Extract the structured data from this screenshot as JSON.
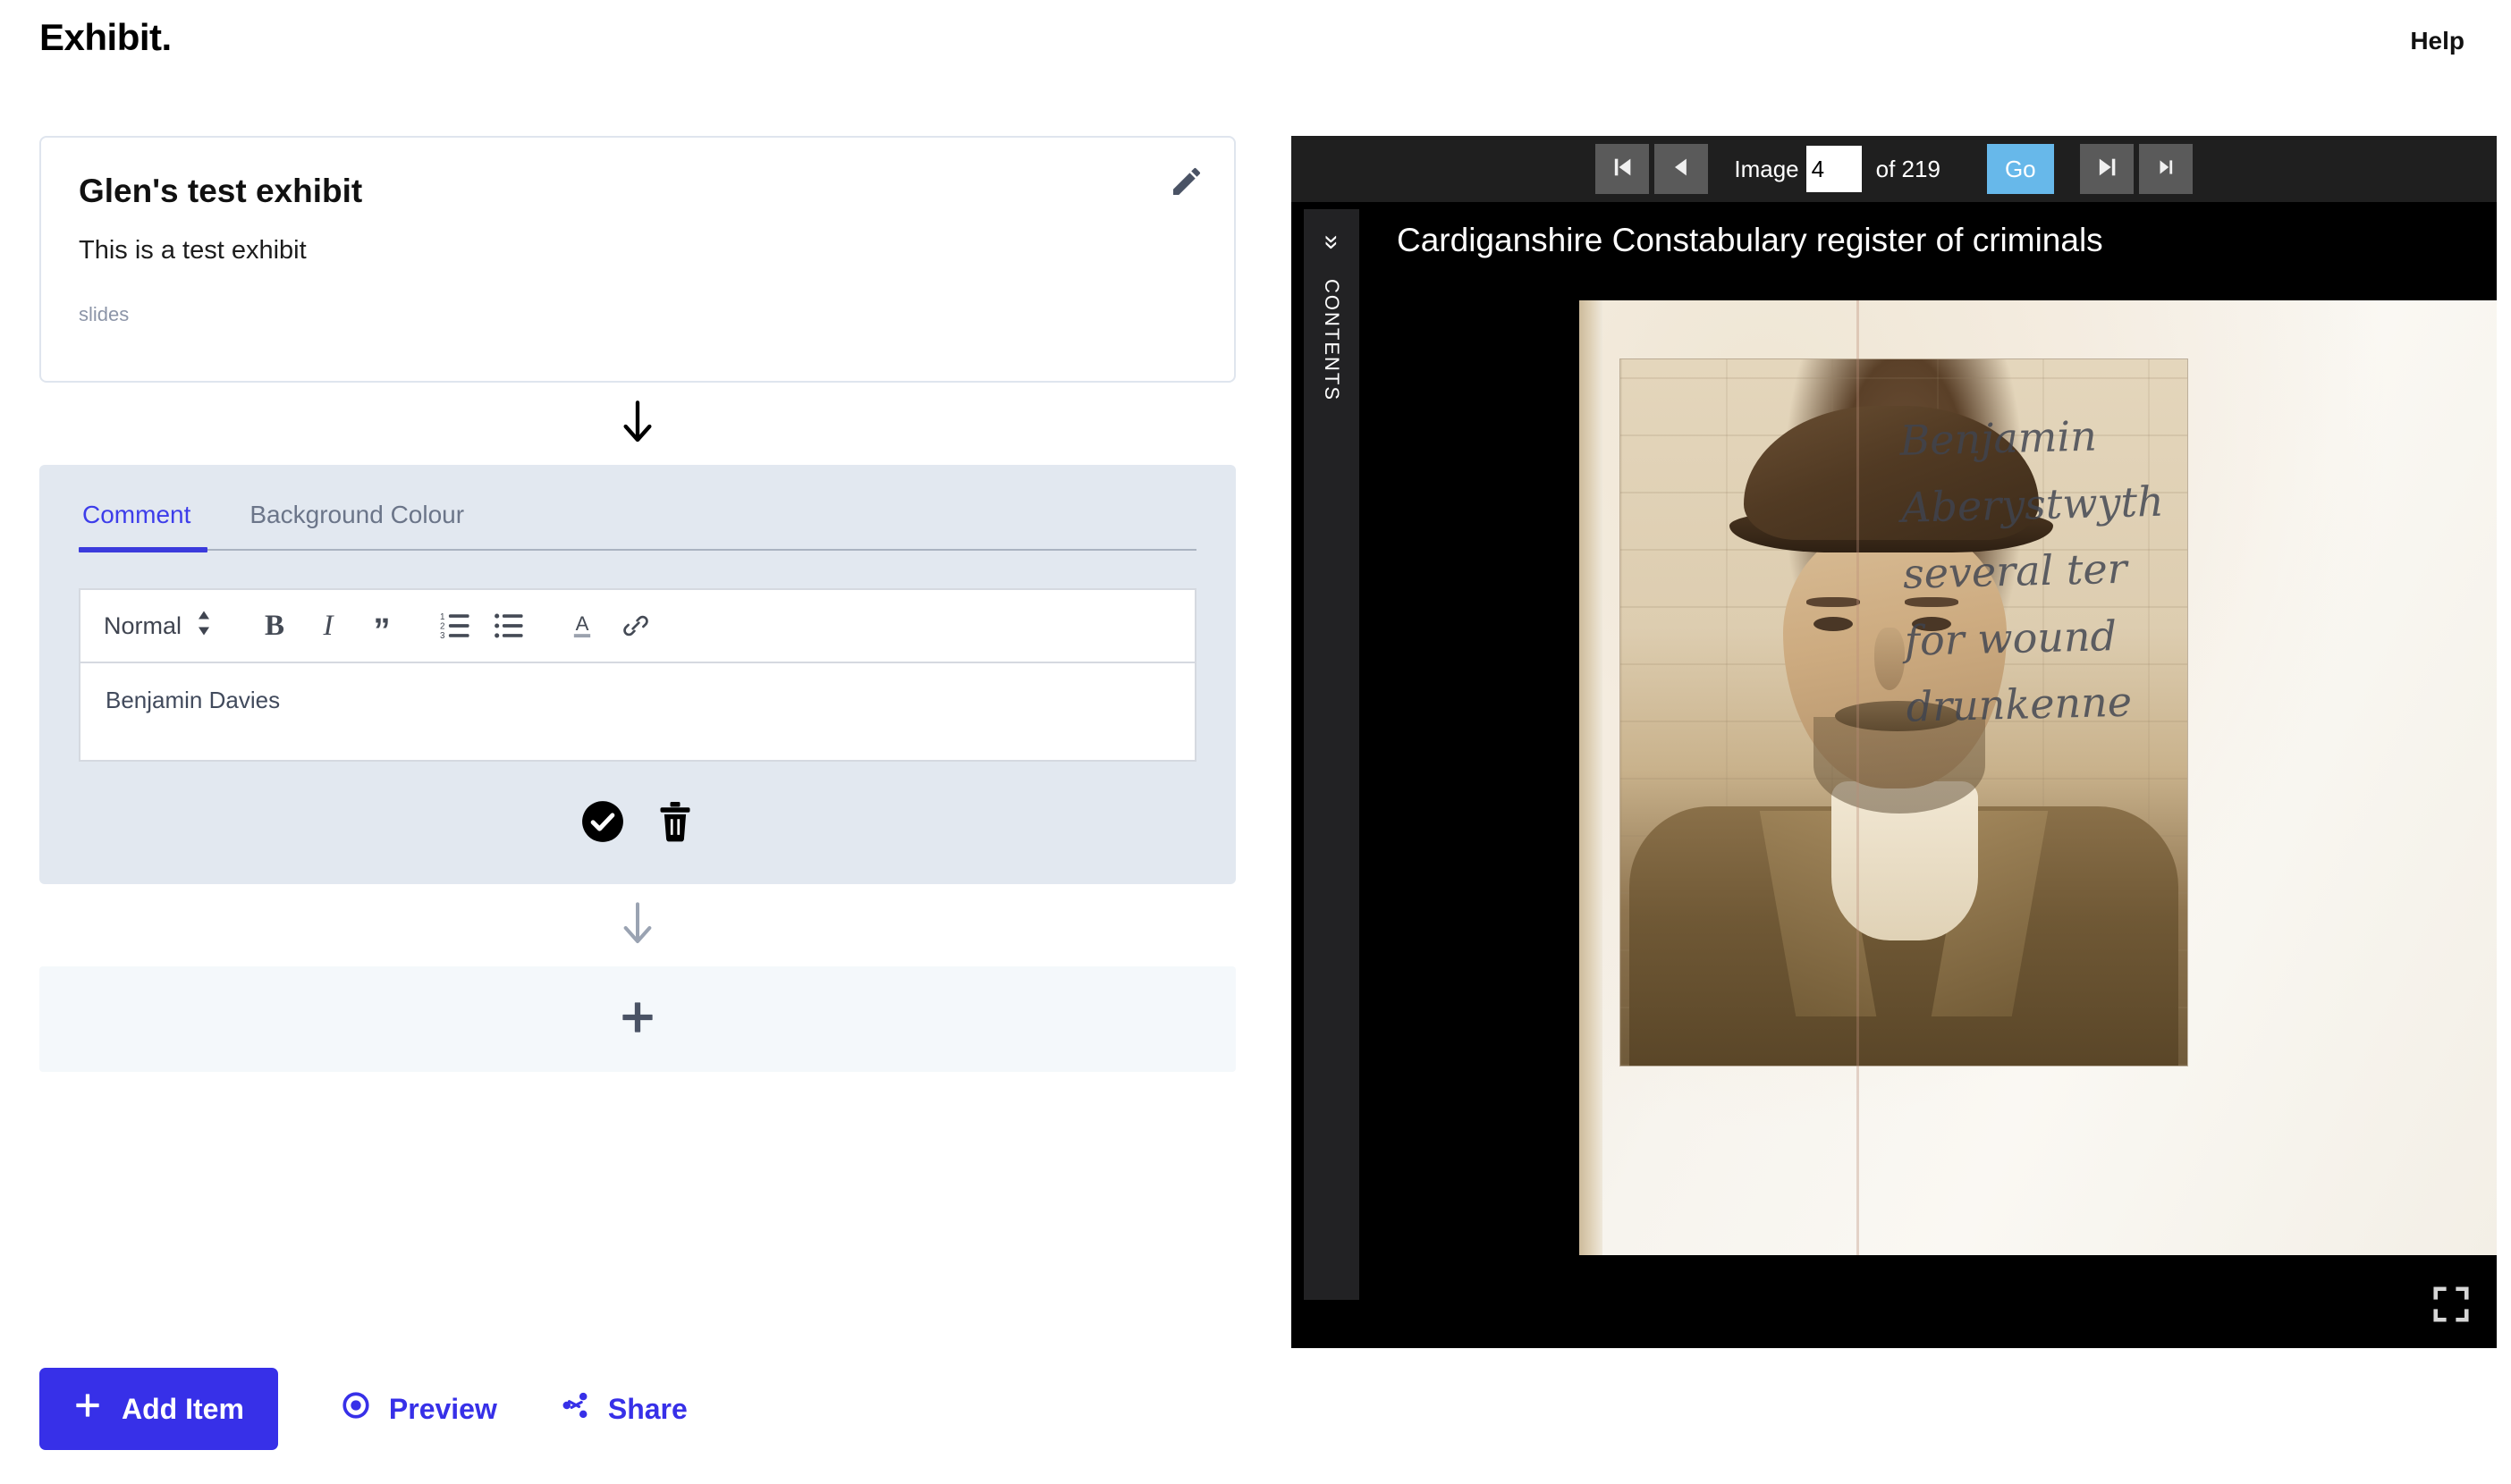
{
  "app": {
    "brand": "Exhibit.",
    "help_label": "Help",
    "accent_blue": "#3730e8",
    "tab_active_blue": "#3d3dea",
    "go_button_blue": "#67b8ea"
  },
  "exhibit": {
    "title": "Glen's test exhibit",
    "description": "This is a test exhibit",
    "meta_label": "slides",
    "edit_icon": "pencil-icon"
  },
  "editor": {
    "tabs": [
      {
        "label": "Comment",
        "active": true
      },
      {
        "label": "Background Colour",
        "active": false
      }
    ],
    "toolbar": {
      "format_value": "Normal",
      "buttons": [
        {
          "name": "bold-icon",
          "glyph": "B"
        },
        {
          "name": "italic-icon",
          "glyph": "I"
        },
        {
          "name": "blockquote-icon",
          "glyph": "”"
        },
        {
          "name": "ordered-list-icon",
          "glyph": "list-ol"
        },
        {
          "name": "bullet-list-icon",
          "glyph": "list-ul"
        },
        {
          "name": "text-colour-icon",
          "glyph": "A"
        },
        {
          "name": "link-icon",
          "glyph": "link"
        }
      ]
    },
    "content": "Benjamin Davies",
    "actions": [
      {
        "name": "confirm-button",
        "label": "confirm-check-icon"
      },
      {
        "name": "delete-button",
        "label": "trash-icon"
      }
    ]
  },
  "flow": {
    "arrow_top": "arrow-down-icon",
    "arrow_bottom": "arrow-down-icon",
    "add_slot_icon": "plus-icon"
  },
  "bottom_actions": {
    "add_item_label": "Add Item",
    "preview_label": "Preview",
    "share_label": "Share"
  },
  "viewer": {
    "nav": {
      "first_label": "first-image",
      "prev_label": "previous-image",
      "next_label": "next-image",
      "last_label": "last-image",
      "image_label": "Image",
      "image_value": "4",
      "of_text": "of 219",
      "total": 219,
      "go_label": "Go"
    },
    "contents_label": "CONTENTS",
    "contents_chevron": "»",
    "title": "Cardiganshire Constabulary register of criminals",
    "fullscreen_icon": "fullscreen-icon",
    "handwriting_lines": [
      "Benjamin",
      "Aberystwyth",
      "several ter",
      "for wound",
      "drunkenne"
    ]
  }
}
